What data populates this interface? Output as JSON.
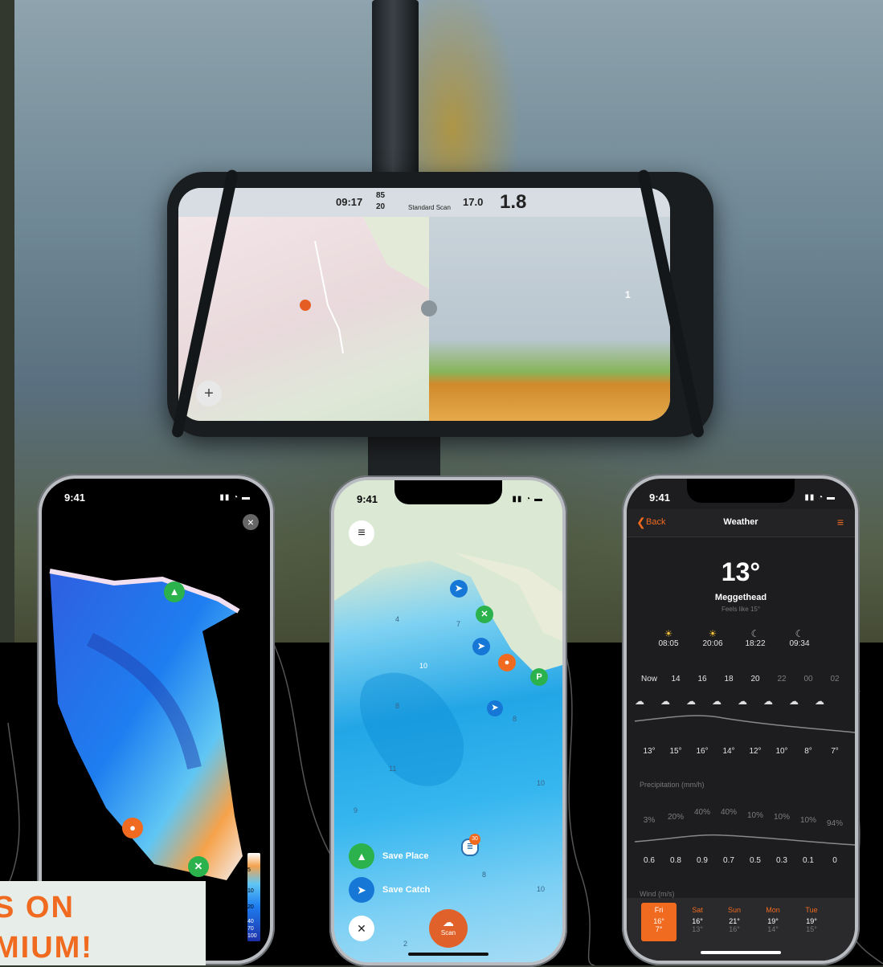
{
  "hero_device": {
    "time": "09:17",
    "battery_top": "85",
    "battery_bottom": "20",
    "mode_label": "Standard Scan",
    "temperature": "17.0",
    "depth": "1.8",
    "depth_marker": "1",
    "zoom_in": "+"
  },
  "phone_3d": {
    "time": "9:41",
    "close_label": "×",
    "legend": [
      "5",
      "10",
      "20",
      "40",
      "70",
      "100"
    ]
  },
  "phone_map": {
    "time": "9:41",
    "depth_labels": [
      "4",
      "7",
      "10",
      "8",
      "11",
      "10",
      "8",
      "9",
      "10",
      "8",
      "2"
    ],
    "parking_label": "P",
    "badge_count": "30",
    "save_place_label": "Save Place",
    "save_catch_label": "Save Catch",
    "scan_label": "Scan"
  },
  "phone_weather": {
    "time": "9:41",
    "back_label": "Back",
    "title": "Weather",
    "temperature": "13°",
    "location": "Meggethead",
    "feels_like": "Feels like 15°",
    "sun_moon_times": [
      "08:05",
      "20:06",
      "18:22",
      "09:34"
    ],
    "hours": [
      "Now",
      "14",
      "16",
      "18",
      "20",
      "22",
      "00",
      "02"
    ],
    "temps": [
      "13°",
      "15°",
      "16°",
      "14°",
      "12°",
      "10°",
      "8°",
      "7°"
    ],
    "precip_title": "Precipitation (mm/h)",
    "precip_pct": [
      "3%",
      "20%",
      "40%",
      "40%",
      "10%",
      "10%",
      "10%",
      "94%"
    ],
    "precip_mm": [
      "0.6",
      "0.8",
      "0.9",
      "0.7",
      "0.5",
      "0.3",
      "0.1",
      "0"
    ],
    "wind_title": "Wind (m/s)",
    "days": [
      {
        "day": "Fri",
        "hi": "16°",
        "lo": "7°"
      },
      {
        "day": "Sat",
        "hi": "16°",
        "lo": "13°"
      },
      {
        "day": "Sun",
        "hi": "21°",
        "lo": "16°"
      },
      {
        "day": "Mon",
        "hi": "19°",
        "lo": "14°"
      },
      {
        "day": "Tue",
        "hi": "19°",
        "lo": "15°"
      }
    ]
  },
  "promo": {
    "line1": "S ON",
    "line2": "MIUM!"
  },
  "colors": {
    "accent_orange": "#f06a1f",
    "map_water": "#1aa3e0",
    "pin_green": "#2bb24c",
    "pin_blue": "#1677d6"
  }
}
